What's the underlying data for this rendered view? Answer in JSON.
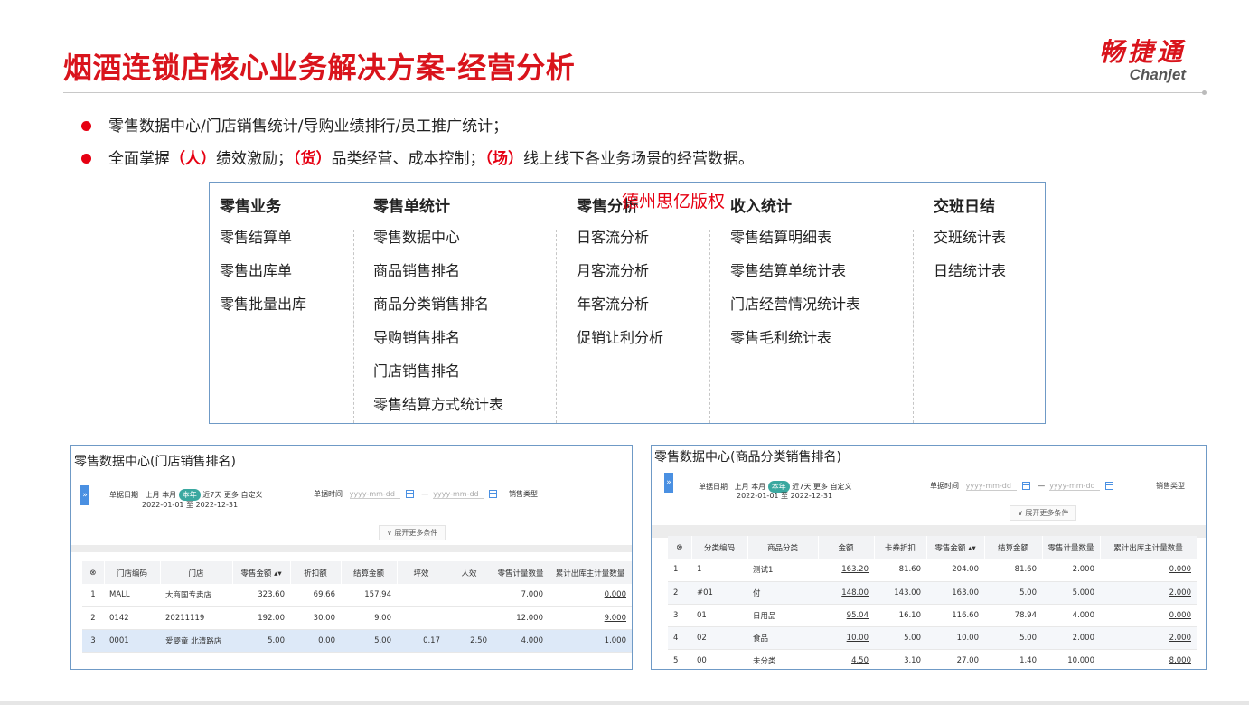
{
  "header": {
    "title": "烟酒连锁店核心业务解决方案-经营分析",
    "logo_cn": "畅捷通",
    "logo_en": "Chanjet"
  },
  "bullets": {
    "b1": "零售数据中心/门店销售统计/导购业绩排行/员工推广统计；",
    "b2_pre": "全面掌握",
    "b2_k1": "（人）",
    "b2_t1": "绩效激励；",
    "b2_k2": "（货）",
    "b2_t2": "品类经营、成本控制；",
    "b2_k3": "（场）",
    "b2_t3": "线上线下各业务场景的经营数据。"
  },
  "watermark": "德州思亿版权",
  "menu": {
    "col1": {
      "head": "零售业务",
      "items": [
        "零售结算单",
        "零售出库单",
        "零售批量出库"
      ]
    },
    "col2": {
      "head": "零售单统计",
      "items": [
        "零售数据中心",
        "商品销售排名",
        "商品分类销售排名",
        "导购销售排名",
        "门店销售排名",
        "零售结算方式统计表"
      ]
    },
    "col3": {
      "head": "零售分析",
      "items": [
        "日客流分析",
        "月客流分析",
        "年客流分析",
        "促销让利分析"
      ]
    },
    "col4": {
      "head": "收入统计",
      "items": [
        "零售结算明细表",
        "零售结算单统计表",
        "门店经营情况统计表",
        "零售毛利统计表"
      ]
    },
    "col5": {
      "head": "交班日结",
      "items": [
        "交班统计表",
        "日结统计表"
      ]
    }
  },
  "left_panel": {
    "title": "零售数据中心(门店销售排名)",
    "expand_tab": "»",
    "filter": {
      "date_label": "单据日期",
      "opts": [
        "上月",
        "本月",
        "本年",
        "近7天",
        "更多",
        "自定义"
      ],
      "active_opt": "本年",
      "range": "2022-01-01 至 2022-12-31",
      "time_label": "单据时间",
      "ph_from": "yyyy-mm-dd",
      "dash": "—",
      "ph_to": "yyyy-mm-dd",
      "type_label": "销售类型",
      "expand": "∨ 展开更多条件"
    },
    "columns": [
      "⊗",
      "门店编码",
      "门店",
      "零售金额 ▴▾",
      "折扣额",
      "结算金额",
      "坪效",
      "人效",
      "零售计量数量",
      "累计出库主计量数量"
    ],
    "rows": [
      [
        "1",
        "MALL",
        "大商国专卖店",
        "323.60",
        "69.66",
        "157.94",
        "",
        "",
        "7.000",
        "0.000"
      ],
      [
        "2",
        "0142",
        "20211119",
        "192.00",
        "30.00",
        "9.00",
        "",
        "",
        "12.000",
        "9.000"
      ],
      [
        "3",
        "0001",
        "爱婴童 北清路店",
        "5.00",
        "0.00",
        "5.00",
        "0.17",
        "2.50",
        "4.000",
        "1.000"
      ]
    ]
  },
  "right_panel": {
    "title": "零售数据中心(商品分类销售排名)",
    "expand_tab": "»",
    "filter": {
      "date_label": "单据日期",
      "opts": [
        "上月",
        "本月",
        "本年",
        "近7天",
        "更多",
        "自定义"
      ],
      "active_opt": "本年",
      "range": "2022-01-01 至 2022-12-31",
      "time_label": "单据时间",
      "ph_from": "yyyy-mm-dd",
      "dash": "—",
      "ph_to": "yyyy-mm-dd",
      "type_label": "销售类型",
      "expand": "∨ 展开更多条件"
    },
    "columns": [
      "⊗",
      "分类编码",
      "商品分类",
      "金额",
      "卡券折扣",
      "零售金额 ▴▾",
      "结算金额",
      "零售计量数量",
      "累计出库主计量数量"
    ],
    "rows": [
      [
        "1",
        "1",
        "测试1",
        "163.20",
        "81.60",
        "204.00",
        "81.60",
        "2.000",
        "0.000"
      ],
      [
        "2",
        "#01",
        "付",
        "148.00",
        "143.00",
        "163.00",
        "5.00",
        "5.000",
        "2.000"
      ],
      [
        "3",
        "01",
        "日用品",
        "95.04",
        "16.10",
        "116.60",
        "78.94",
        "4.000",
        "0.000"
      ],
      [
        "4",
        "02",
        "食品",
        "10.00",
        "5.00",
        "10.00",
        "5.00",
        "2.000",
        "2.000"
      ],
      [
        "5",
        "00",
        "未分类",
        "4.50",
        "3.10",
        "27.00",
        "1.40",
        "10.000",
        "8.000"
      ]
    ]
  }
}
